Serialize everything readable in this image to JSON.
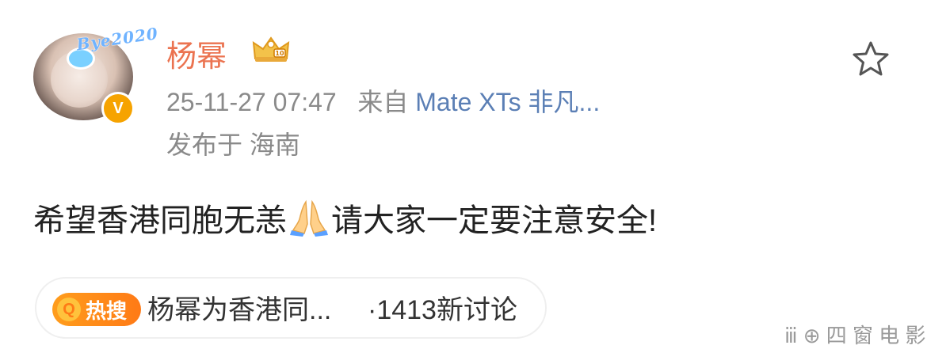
{
  "post": {
    "avatar_deco_text": "Bye2020",
    "verified_mark": "V",
    "username": "杨幂",
    "timestamp": "25-11-27 07:47",
    "source_prefix": "来自",
    "source_device": "Mate XTs 非凡...",
    "location": "发布于 海南",
    "body_part1": "希望香港同胞无恙",
    "body_part2": "请大家一定要注意安全!",
    "icons": {
      "crown": "crown-icon",
      "star": "star-icon",
      "pray": "pray-emoji-icon"
    }
  },
  "hot_search": {
    "badge_icon_glyph": "Q",
    "badge_label": "热搜",
    "title": "杨幂为香港同...",
    "count": "·1413新讨论"
  },
  "watermark": "  ⅲ ⊕ 四 窗 电 影",
  "colors": {
    "username": "#eb7350",
    "meta": "#8a8a8a",
    "link": "#5b7fb5",
    "hot_badge": "#ff7a16",
    "verified": "#f6a300"
  }
}
